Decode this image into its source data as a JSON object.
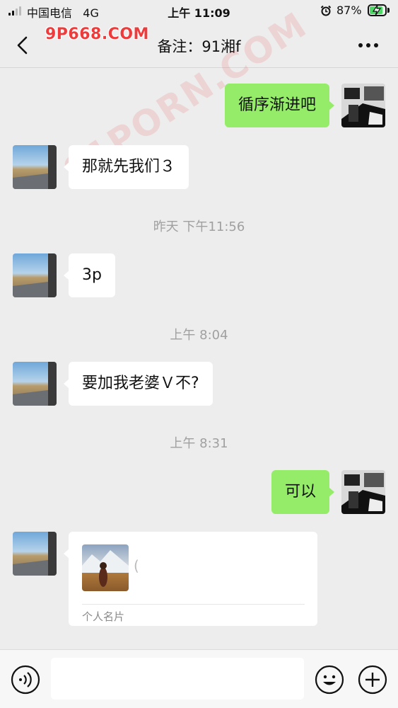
{
  "status_bar": {
    "carrier": "中国电信",
    "network": "4G",
    "time": "上午 11:09",
    "battery_percent": "87%",
    "battery_level": 0.87,
    "icons": [
      "signal-icon",
      "alarm-icon",
      "battery-charging-icon"
    ]
  },
  "nav": {
    "title": "备注：91湘f",
    "back_icon": "chevron-left-icon",
    "more_icon": "more-icon"
  },
  "watermarks": [
    "9P668.COM",
    "91PORN.COM"
  ],
  "messages": [
    {
      "type": "text",
      "direction": "out",
      "text": "循序渐进吧"
    },
    {
      "type": "text",
      "direction": "in",
      "text": "那就先我们３"
    },
    {
      "type": "timestamp",
      "text": "昨天 下午11:56"
    },
    {
      "type": "text",
      "direction": "in",
      "text": "3p"
    },
    {
      "type": "timestamp",
      "text": "上午 8:04"
    },
    {
      "type": "text",
      "direction": "in",
      "text": "要加我老婆Ｖ不?"
    },
    {
      "type": "timestamp",
      "text": "上午 8:31"
    },
    {
      "type": "text",
      "direction": "out",
      "text": "可以"
    },
    {
      "type": "card",
      "direction": "in",
      "name": "(",
      "label": "个人名片"
    }
  ],
  "input_bar": {
    "placeholder": "",
    "value": "",
    "icons": [
      "voice-icon",
      "emoji-icon",
      "plus-icon"
    ]
  },
  "colors": {
    "background": "#ededed",
    "outgoing_bubble": "#95ec69",
    "incoming_bubble": "#ffffff",
    "timestamp_text": "#a0a0a0",
    "watermark": "#ee3c3c"
  }
}
